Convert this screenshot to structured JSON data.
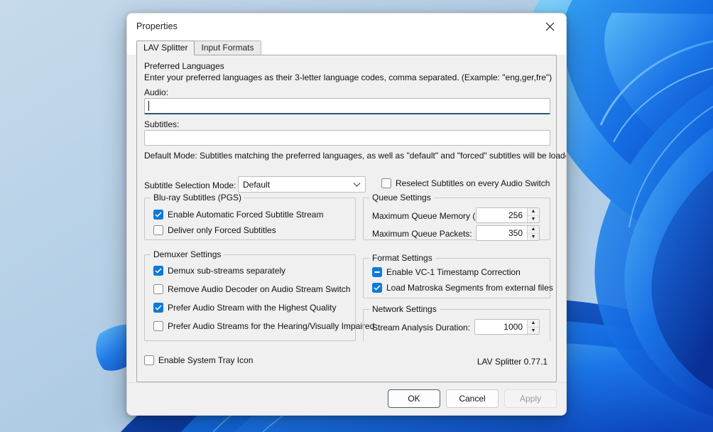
{
  "window": {
    "title": "Properties",
    "close_icon": "close-icon"
  },
  "tabs": [
    {
      "label": "LAV Splitter",
      "active": true
    },
    {
      "label": "Input Formats",
      "active": false
    }
  ],
  "preferred_languages": {
    "heading": "Preferred Languages",
    "description": "Enter your preferred languages as their 3-letter language codes, comma separated. (Example: \"eng,ger,fre\")",
    "audio_label": "Audio:",
    "audio_value": "",
    "subtitles_label": "Subtitles:",
    "subtitles_value": "",
    "default_mode_note": "Default Mode: Subtitles matching the preferred languages, as well as \"default\" and \"forced\" subtitles will be loaded."
  },
  "subtitle_selection": {
    "label": "Subtitle Selection Mode:",
    "value": "Default",
    "options": [
      "Default"
    ],
    "reselect_label": "Reselect Subtitles on every Audio Switch",
    "reselect_checked": false
  },
  "bluray_group": {
    "title": "Blu-ray Subtitles (PGS)",
    "items": [
      {
        "label": "Enable Automatic Forced Subtitle Stream",
        "state": "checked"
      },
      {
        "label": "Deliver only Forced Subtitles",
        "state": "unchecked"
      }
    ]
  },
  "queue_group": {
    "title": "Queue Settings",
    "fields": [
      {
        "label": "Maximum Queue Memory (MB):",
        "value": "256"
      },
      {
        "label": "Maximum Queue Packets:",
        "value": "350"
      }
    ]
  },
  "demuxer_group": {
    "title": "Demuxer Settings",
    "items": [
      {
        "label": "Demux sub-streams separately",
        "state": "checked"
      },
      {
        "label": "Remove Audio Decoder on Audio Stream Switch",
        "state": "unchecked"
      },
      {
        "label": "Prefer Audio Stream with the Highest Quality",
        "state": "checked"
      },
      {
        "label": "Prefer Audio Streams for the Hearing/Visually Impaired",
        "state": "unchecked"
      }
    ]
  },
  "format_group": {
    "title": "Format Settings",
    "items": [
      {
        "label": "Enable VC-1 Timestamp Correction",
        "state": "indeterminate"
      },
      {
        "label": "Load Matroska Segments from external files",
        "state": "checked"
      }
    ]
  },
  "network_group": {
    "title": "Network Settings",
    "fields": [
      {
        "label": "Stream Analysis Duration:",
        "value": "1000"
      }
    ]
  },
  "tray": {
    "label": "Enable System Tray Icon",
    "checked": false
  },
  "version_text": "LAV Splitter 0.77.1",
  "buttons": {
    "ok": "OK",
    "cancel": "Cancel",
    "apply": "Apply"
  },
  "colors": {
    "accent": "#0f7ad6",
    "focus_underline": "#2d5770",
    "dialog_bg": "#f0f0f0",
    "titlebar_bg": "#ffffff"
  },
  "spinner_icons": {
    "up": "▲",
    "down": "▼"
  },
  "combo_icon": "chevron-down-icon"
}
